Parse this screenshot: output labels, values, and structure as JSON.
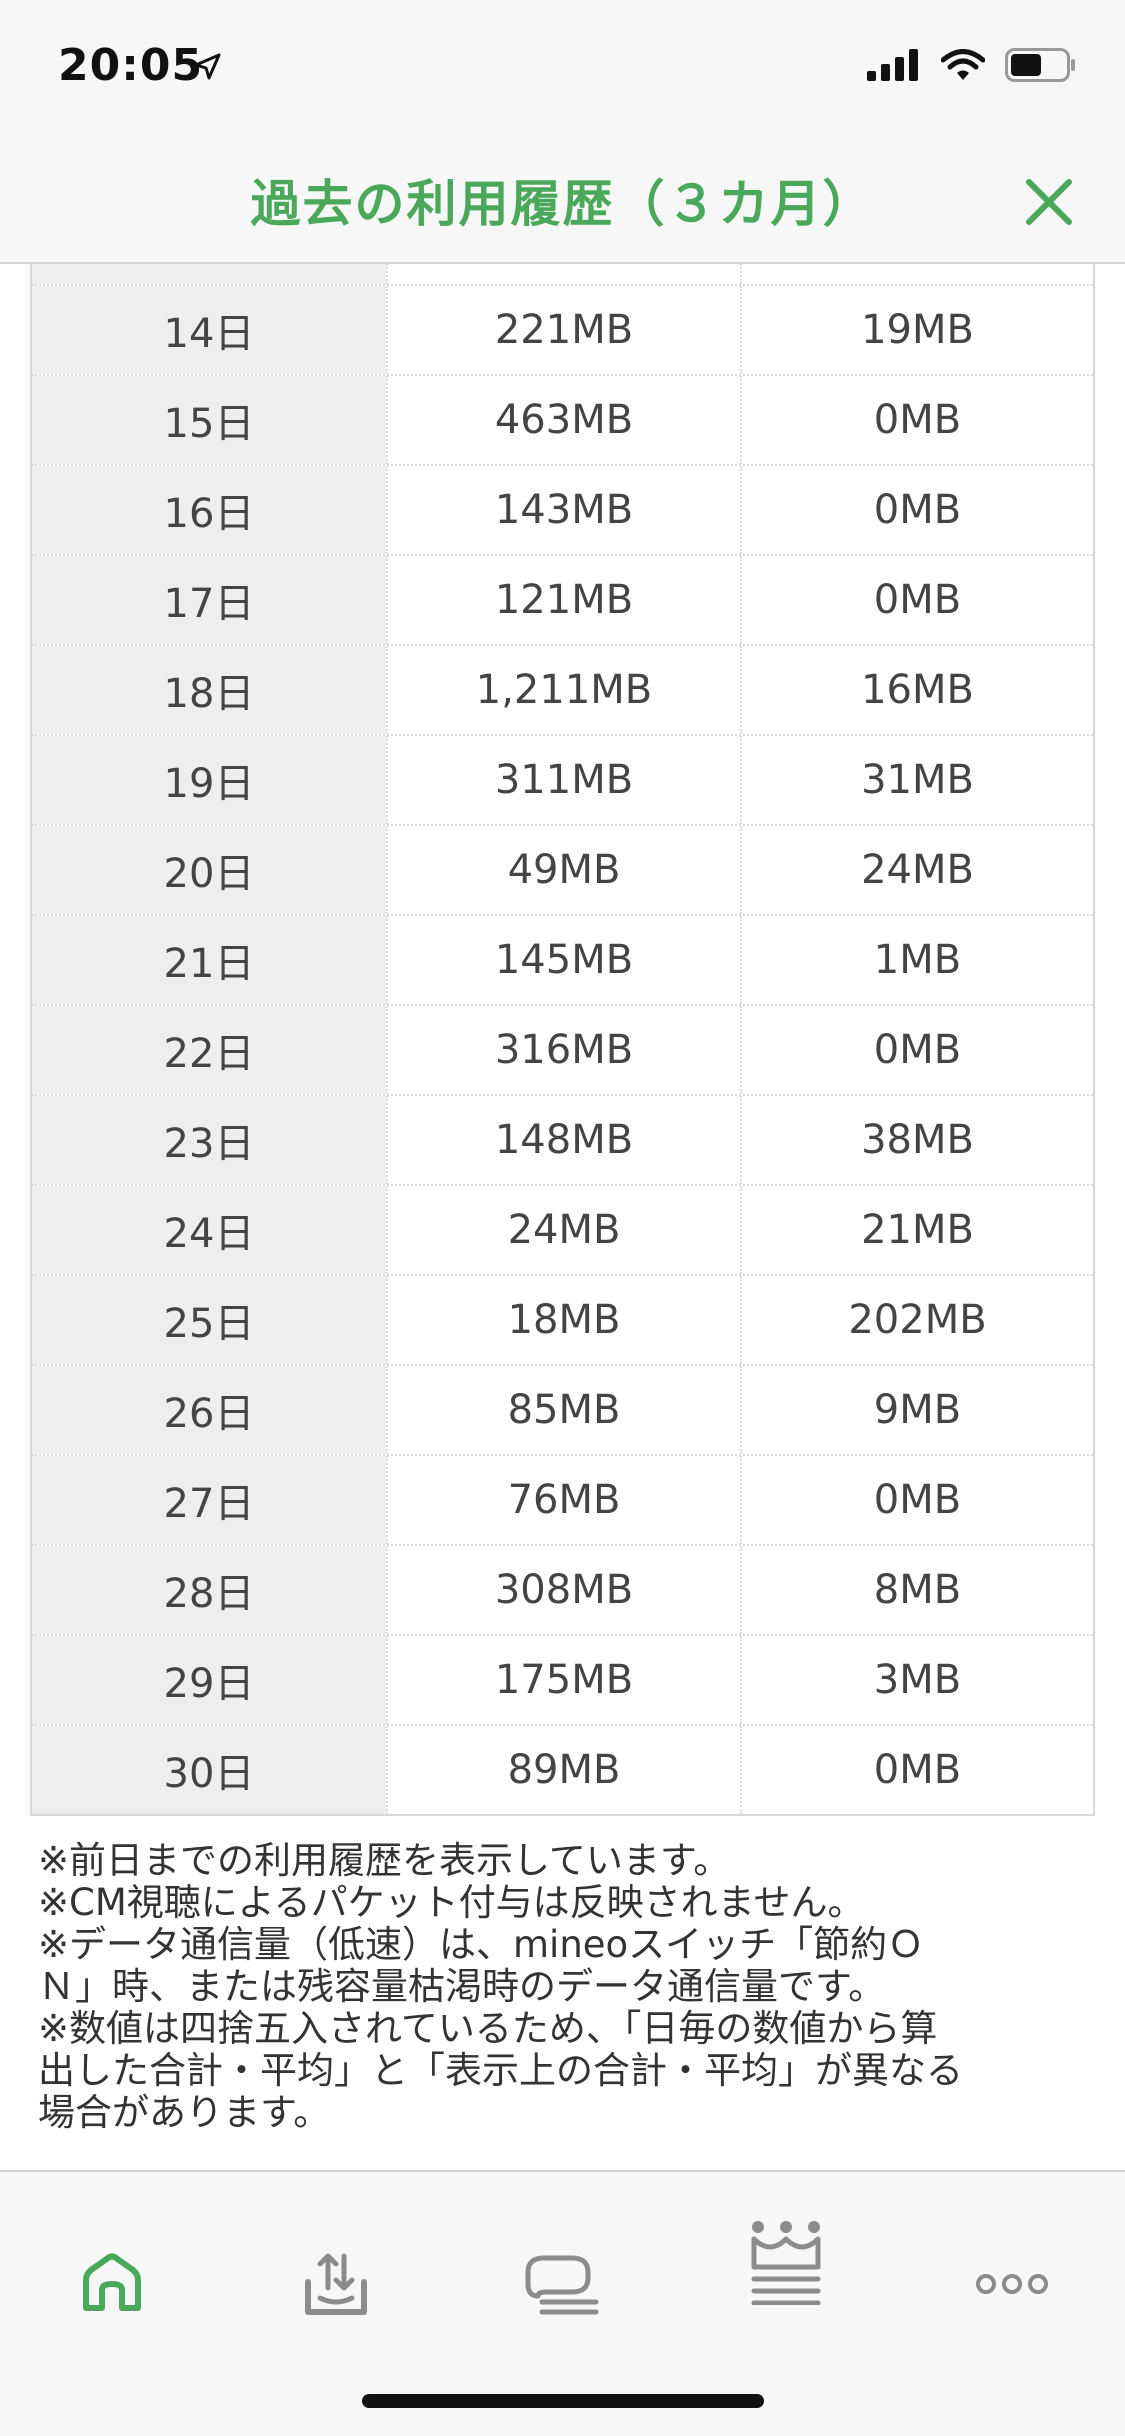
{
  "status_bar": {
    "time": "20:05"
  },
  "header": {
    "title": "過去の利用履歴（３カ月）",
    "accent_color": "#4aa85a"
  },
  "table": {
    "rows": [
      {
        "day": "14日",
        "high_speed": "221MB",
        "low_speed": "19MB"
      },
      {
        "day": "15日",
        "high_speed": "463MB",
        "low_speed": "0MB"
      },
      {
        "day": "16日",
        "high_speed": "143MB",
        "low_speed": "0MB"
      },
      {
        "day": "17日",
        "high_speed": "121MB",
        "low_speed": "0MB"
      },
      {
        "day": "18日",
        "high_speed": "1,211MB",
        "low_speed": "16MB"
      },
      {
        "day": "19日",
        "high_speed": "311MB",
        "low_speed": "31MB"
      },
      {
        "day": "20日",
        "high_speed": "49MB",
        "low_speed": "24MB"
      },
      {
        "day": "21日",
        "high_speed": "145MB",
        "low_speed": "1MB"
      },
      {
        "day": "22日",
        "high_speed": "316MB",
        "low_speed": "0MB"
      },
      {
        "day": "23日",
        "high_speed": "148MB",
        "low_speed": "38MB"
      },
      {
        "day": "24日",
        "high_speed": "24MB",
        "low_speed": "21MB"
      },
      {
        "day": "25日",
        "high_speed": "18MB",
        "low_speed": "202MB"
      },
      {
        "day": "26日",
        "high_speed": "85MB",
        "low_speed": "9MB"
      },
      {
        "day": "27日",
        "high_speed": "76MB",
        "low_speed": "0MB"
      },
      {
        "day": "28日",
        "high_speed": "308MB",
        "low_speed": "8MB"
      },
      {
        "day": "29日",
        "high_speed": "175MB",
        "low_speed": "3MB"
      },
      {
        "day": "30日",
        "high_speed": "89MB",
        "low_speed": "0MB"
      }
    ]
  },
  "notes": [
    "※前日までの利用履歴を表示しています。",
    "※CM視聴によるパケット付与は反映されません。",
    "※データ通信量（低速）は、mineoスイッチ「節約Ｏ",
    "Ｎ」時、または残容量枯渇時のデータ通信量です。",
    "※数値は四捨五入されているため、「日毎の数値から算",
    "出した合計・平均」と「表示上の合計・平均」が異なる",
    "場合があります。"
  ],
  "tab_bar": {
    "tabs": [
      {
        "icon": "home-icon",
        "active": true
      },
      {
        "icon": "share-tray-icon",
        "active": false
      },
      {
        "icon": "chat-bubble-icon",
        "active": false
      },
      {
        "icon": "crown-icon",
        "active": false
      },
      {
        "icon": "more-icon",
        "active": false
      }
    ],
    "active_color": "#4aa85a",
    "inactive_color": "#8c8c8c"
  }
}
